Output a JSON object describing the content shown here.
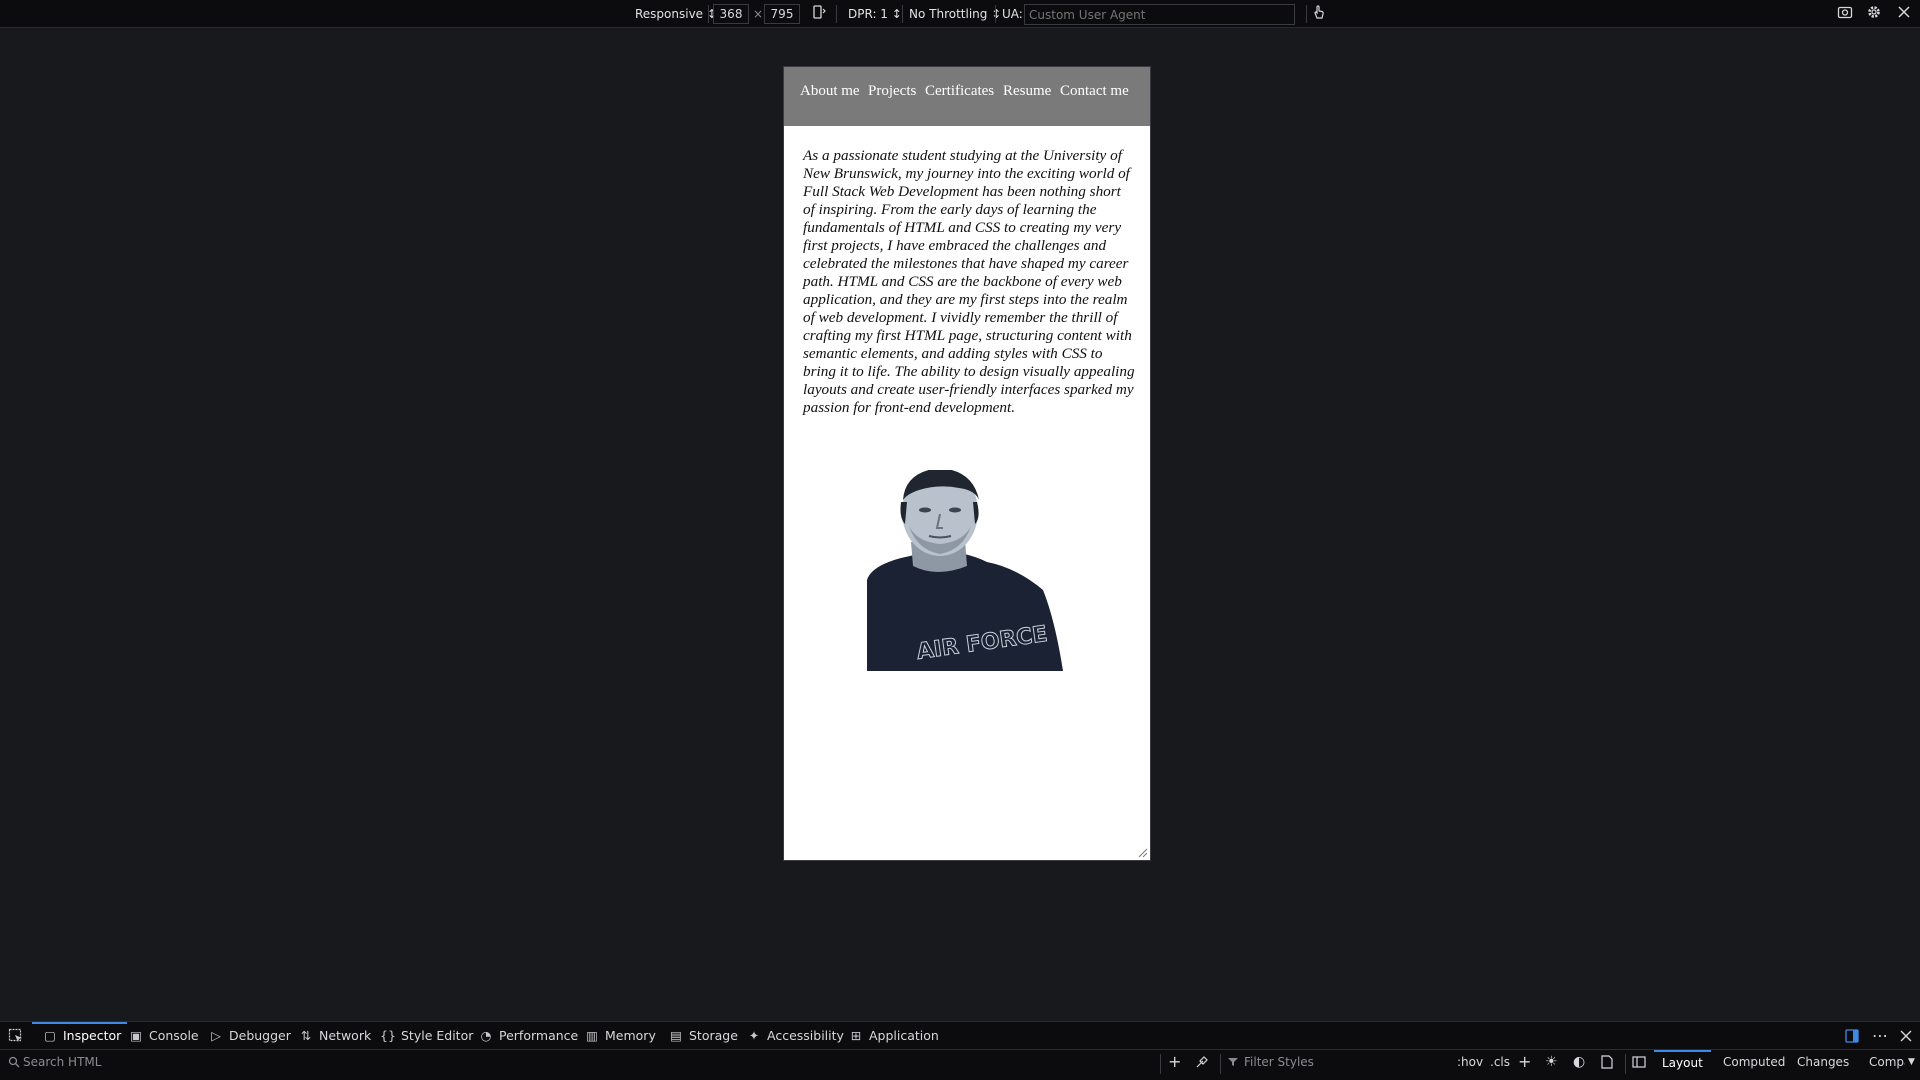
{
  "rdm": {
    "device_select": "Responsive ↕",
    "width": "368",
    "times": "×",
    "height": "795",
    "dpr": "DPR: 1 ↕",
    "throttling": "No Throttling ↕",
    "ua_label": "UA:",
    "ua_placeholder": "Custom User Agent"
  },
  "page": {
    "nav": [
      "About me",
      "Projects",
      "Certificates",
      "Resume",
      "Contact me"
    ],
    "about_text": "As a passionate student studying at the University of New Brunswick, my journey into the exciting world of Full Stack Web Development has been nothing short of inspiring. From the early days of learning the fundamentals of HTML and CSS to creating my very first projects, I have embraced the challenges and celebrated the milestones that have shaped my career path. HTML and CSS are the backbone of every web application, and they are my first steps into the realm of web development. I vividly remember the thrill of crafting my first HTML page, structuring content with semantic elements, and adding styles with CSS to bring it to life. The ability to design visually appealing layouts and create user-friendly interfaces sparked my passion for front-end development.",
    "shirt_text": "AIR FORCE"
  },
  "devtools": {
    "tabs": [
      "Inspector",
      "Console",
      "Debugger",
      "Network",
      "Style Editor",
      "Performance",
      "Memory",
      "Storage",
      "Accessibility",
      "Application"
    ],
    "search_html_placeholder": "Search HTML",
    "filter_styles_placeholder": "Filter Styles",
    "hov": ":hov",
    "cls": ".cls",
    "side_tabs": [
      "Layout",
      "Computed",
      "Changes",
      "Compa"
    ]
  },
  "colors": {
    "accent": "#3f89e6",
    "nav_bg": "#7a7a7a",
    "background": "#18191c"
  }
}
